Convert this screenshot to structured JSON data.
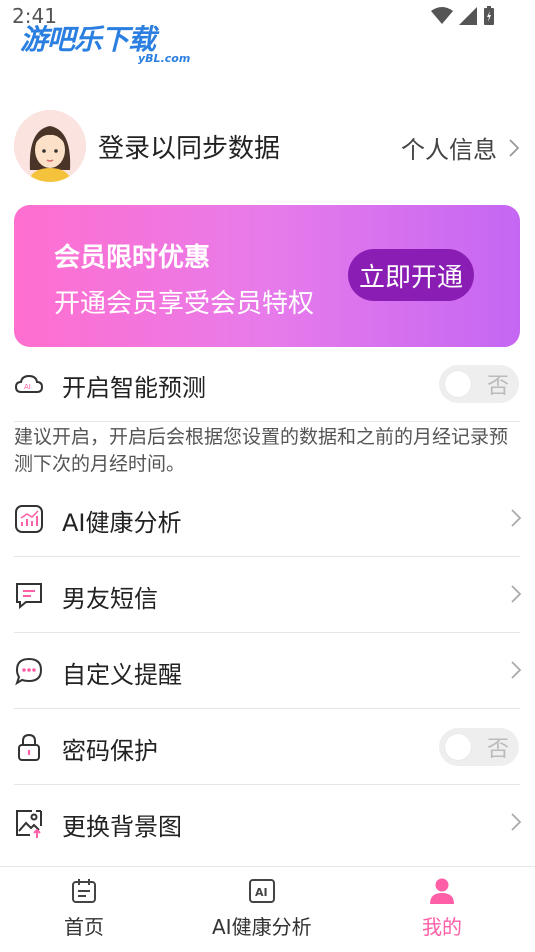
{
  "status_bar": {
    "time": "2:41"
  },
  "watermark": {
    "main": "游吧乐下载",
    "sub": "yBL.com"
  },
  "profile": {
    "login_text": "登录以同步数据",
    "link_label": "个人信息"
  },
  "vip": {
    "title": "会员限时优惠",
    "subtitle": "开通会员享受会员特权",
    "button": "立即开通"
  },
  "prediction": {
    "label": "开启智能预测",
    "toggle_text": "否",
    "hint": "建议开启，开启后会根据您设置的数据和之前的月经记录预测下次的月经时间。"
  },
  "menu": [
    {
      "label": "AI健康分析",
      "icon": "chart-icon"
    },
    {
      "label": "男友短信",
      "icon": "message-icon"
    },
    {
      "label": "自定义提醒",
      "icon": "chat-dots-icon"
    },
    {
      "label": "密码保护",
      "icon": "lock-icon",
      "toggle_text": "否"
    },
    {
      "label": "更换背景图",
      "icon": "image-icon"
    }
  ],
  "bottom_nav": [
    {
      "label": "首页",
      "icon": "calendar-icon"
    },
    {
      "label": "AI健康分析",
      "icon": "ai-icon"
    },
    {
      "label": "我的",
      "icon": "user-icon",
      "active": true
    }
  ],
  "colors": {
    "accent": "#ff5fa7",
    "vip_button": "#8a1db3",
    "vip_gradient_start": "#ff6fcf",
    "vip_gradient_end": "#c567f3"
  }
}
